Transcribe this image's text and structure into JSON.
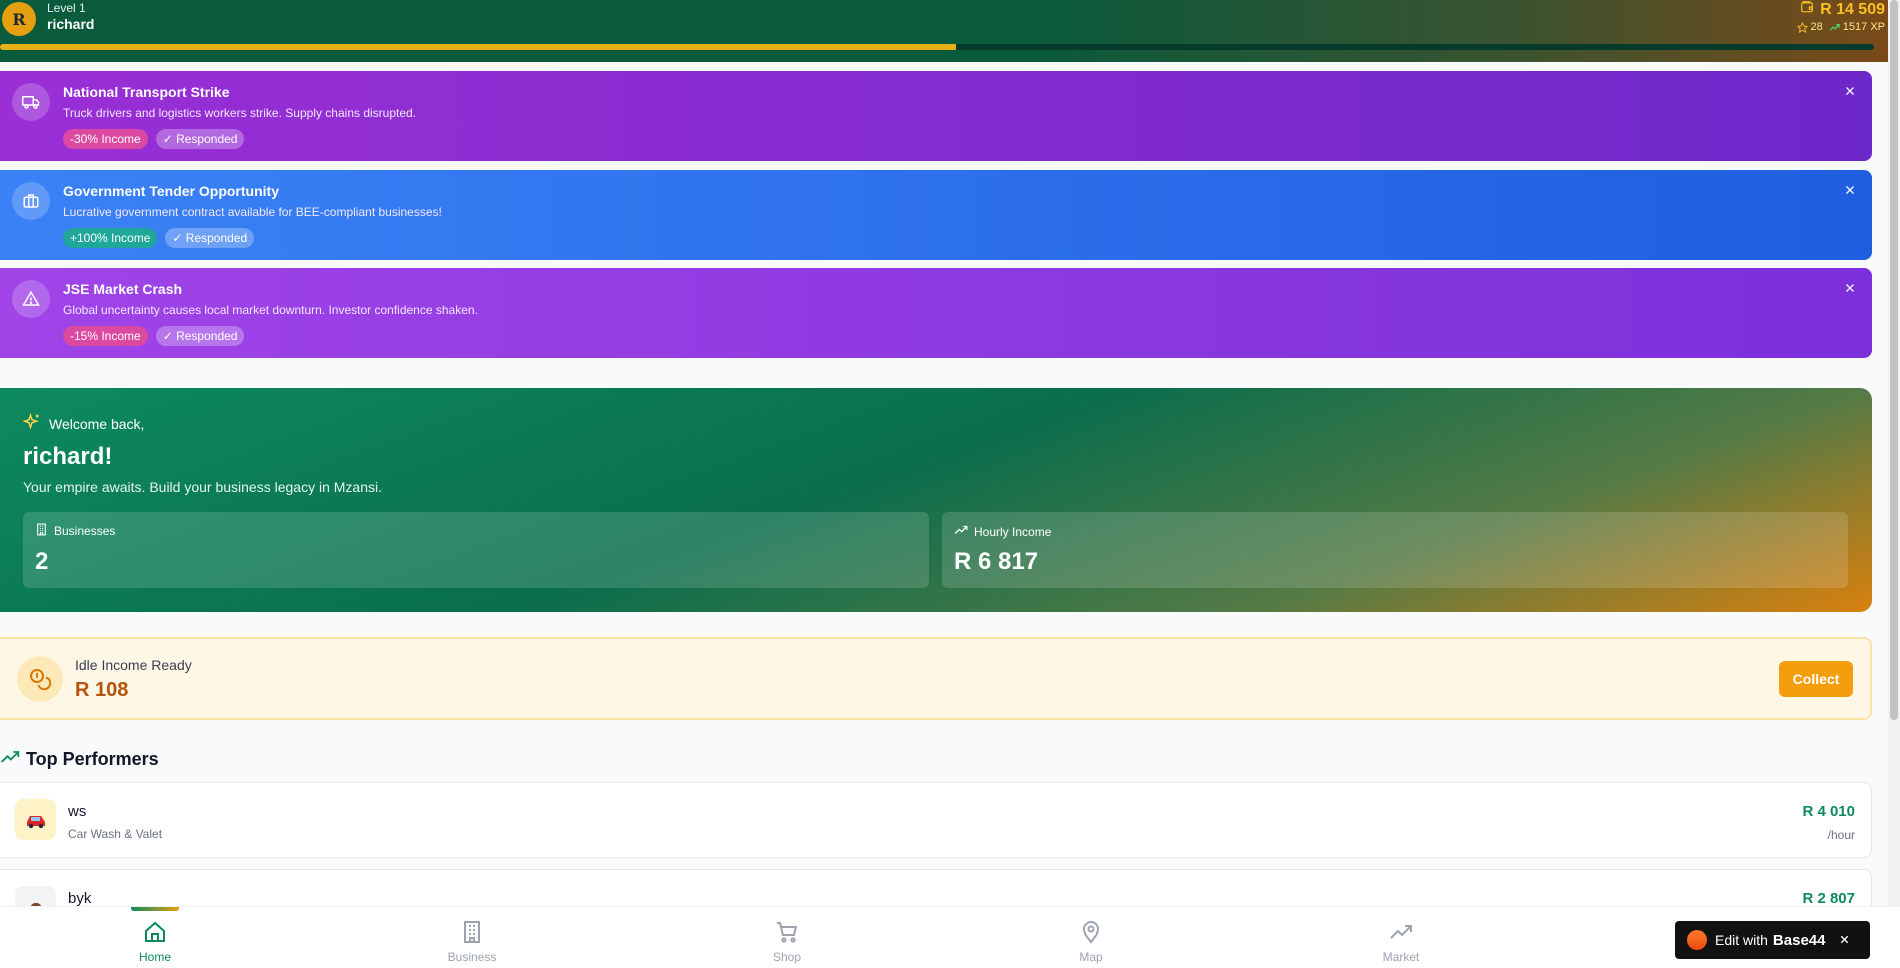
{
  "header": {
    "avatar_initial": "R",
    "level": "Level 1",
    "username": "richard",
    "money": "R 14 509",
    "stars": "28",
    "xp": "1517 XP",
    "xp_progress_percent": 51,
    "colors": {
      "accent_gold": "#fbbf24",
      "brand_green": "#0a5a3c"
    }
  },
  "events": [
    {
      "title": "National Transport Strike",
      "description": "Truck drivers and logistics workers strike. Supply chains disrupted.",
      "effect": "-30% Income",
      "status": "✓ Responded",
      "icon": "truck-icon"
    },
    {
      "title": "Government Tender Opportunity",
      "description": "Lucrative government contract available for BEE-compliant businesses!",
      "effect": "+100% Income",
      "status": "✓ Responded",
      "icon": "briefcase-icon"
    },
    {
      "title": "JSE Market Crash",
      "description": "Global uncertainty causes local market downturn. Investor confidence shaken.",
      "effect": "-15% Income",
      "status": "✓ Responded",
      "icon": "warning-icon"
    }
  ],
  "welcome": {
    "greeting": "Welcome back,",
    "name": "richard!",
    "subtitle": "Your empire awaits. Build your business legacy in Mzansi.",
    "businesses_label": "Businesses",
    "businesses_value": "2",
    "hourly_label": "Hourly Income",
    "hourly_value": "R 6 817"
  },
  "idle": {
    "label": "Idle Income Ready",
    "value": "R 108",
    "collect_label": "Collect"
  },
  "top_performers": {
    "title": "Top Performers",
    "items": [
      {
        "name": "ws",
        "type": "Car Wash & Valet",
        "income": "R 4 010",
        "unit": "/hour",
        "icon": "car-icon"
      },
      {
        "name": "byk",
        "type": "",
        "income": "R 2 807",
        "unit": "",
        "icon": "business-icon"
      }
    ]
  },
  "nav": {
    "items": [
      {
        "label": "Home",
        "icon": "home-icon",
        "active": true
      },
      {
        "label": "Business",
        "icon": "building-icon"
      },
      {
        "label": "Shop",
        "icon": "cart-icon"
      },
      {
        "label": "Map",
        "icon": "map-pin-icon"
      },
      {
        "label": "Market",
        "icon": "trending-icon"
      }
    ]
  },
  "badge": {
    "text": "Edit with",
    "brand": "Base44"
  }
}
